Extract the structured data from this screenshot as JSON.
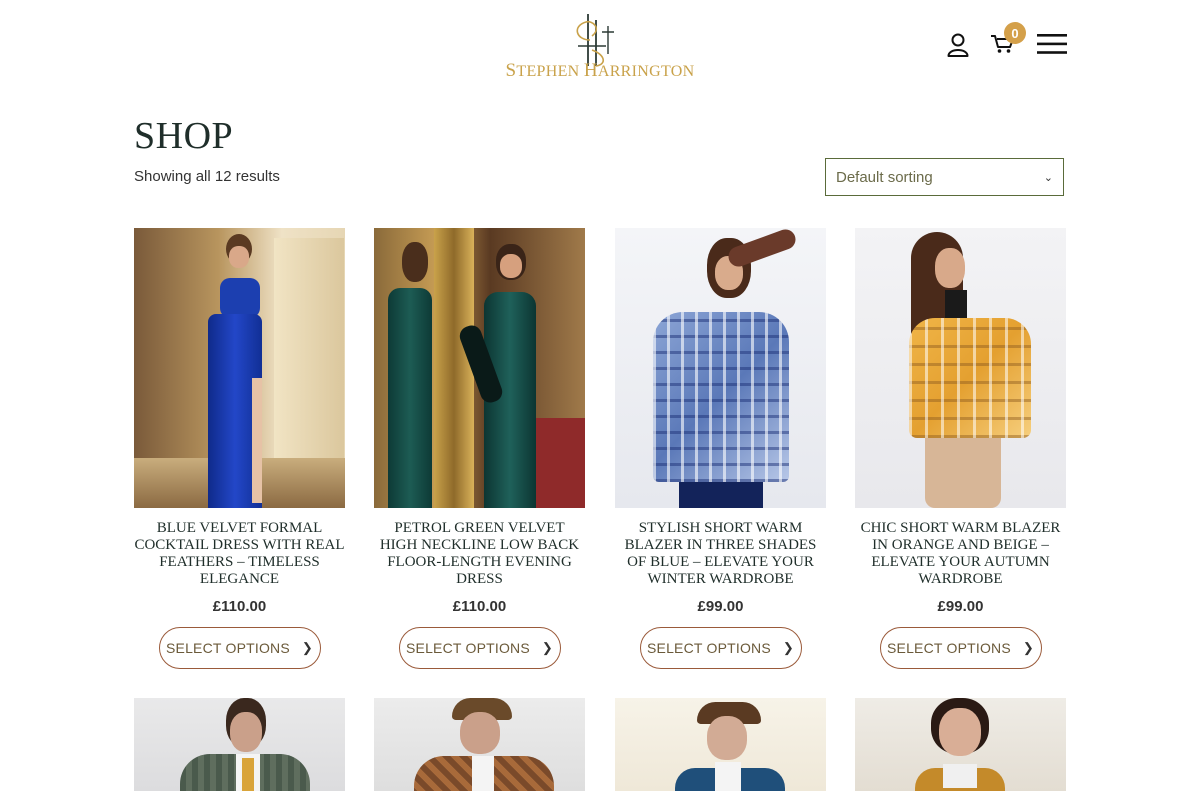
{
  "header": {
    "brand": "Stephen Harrington",
    "brand_first_cap": "S",
    "brand_first_rest": "TEPHEN ",
    "brand_second_cap": "H",
    "brand_second_rest": "ARRINGTON",
    "cart_count": "0",
    "icons": [
      "account-icon",
      "cart-icon",
      "menu-icon"
    ]
  },
  "page": {
    "title": "SHOP",
    "result_count": "Showing all 12 results",
    "sort_selected": "Default sorting"
  },
  "colors": {
    "accent": "#d4a04a",
    "title": "#1f2e2a",
    "button_border": "#9a5a3a"
  },
  "products": [
    {
      "name": "Blue Velvet Formal Cocktail Dress with Real Feathers – Timeless Elegance",
      "price": "£110.00",
      "button": "SELECT OPTIONS"
    },
    {
      "name": "Petrol Green Velvet High Neckline Low Back Floor-Length Evening Dress",
      "price": "£110.00",
      "button": "SELECT OPTIONS"
    },
    {
      "name": "Stylish Short Warm Blazer in Three Shades of Blue – Elevate Your Winter Wardrobe",
      "price": "£99.00",
      "button": "SELECT OPTIONS"
    },
    {
      "name": "Chic Short Warm Blazer in Orange and Beige – Elevate Your Autumn Wardrobe",
      "price": "£99.00",
      "button": "SELECT OPTIONS"
    }
  ]
}
